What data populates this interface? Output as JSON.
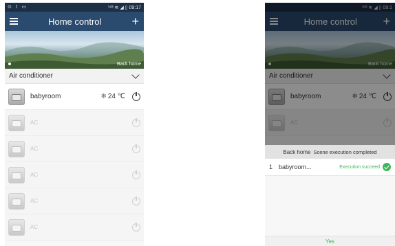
{
  "status_bar": {
    "time": "09:17",
    "time_right": "09:1",
    "left_icons": "⊙ ⟟ ▭",
    "right_icons": "ⁱ⁴ᴳ ≋ ◢ ▯"
  },
  "app_bar": {
    "title": "Home control"
  },
  "banner": {
    "scene_label": "Back home"
  },
  "category": {
    "label": "Air conditioner"
  },
  "devices": [
    {
      "name": "babyroom",
      "temperature": "24 ℃",
      "active": true
    },
    {
      "name": "AC",
      "active": false
    },
    {
      "name": "AC",
      "active": false
    },
    {
      "name": "AC",
      "active": false
    },
    {
      "name": "AC",
      "active": false
    },
    {
      "name": "AC",
      "active": false
    }
  ],
  "dialog": {
    "scene_name": "Back home",
    "message": "Scene execution completed",
    "results": [
      {
        "index": "1",
        "room": "babyroom...",
        "status": "Execution succeed"
      }
    ],
    "confirm_label": "Yes"
  },
  "icons": {
    "menu": "menu-icon",
    "add": "plus-icon",
    "mode": "snowflake-icon",
    "power": "power-icon",
    "expand": "chevron-down-icon",
    "success": "check-circle-icon"
  },
  "colors": {
    "app_bar": "#2a4a6e",
    "status_bar": "#1d2f45",
    "success": "#3fb65b"
  }
}
